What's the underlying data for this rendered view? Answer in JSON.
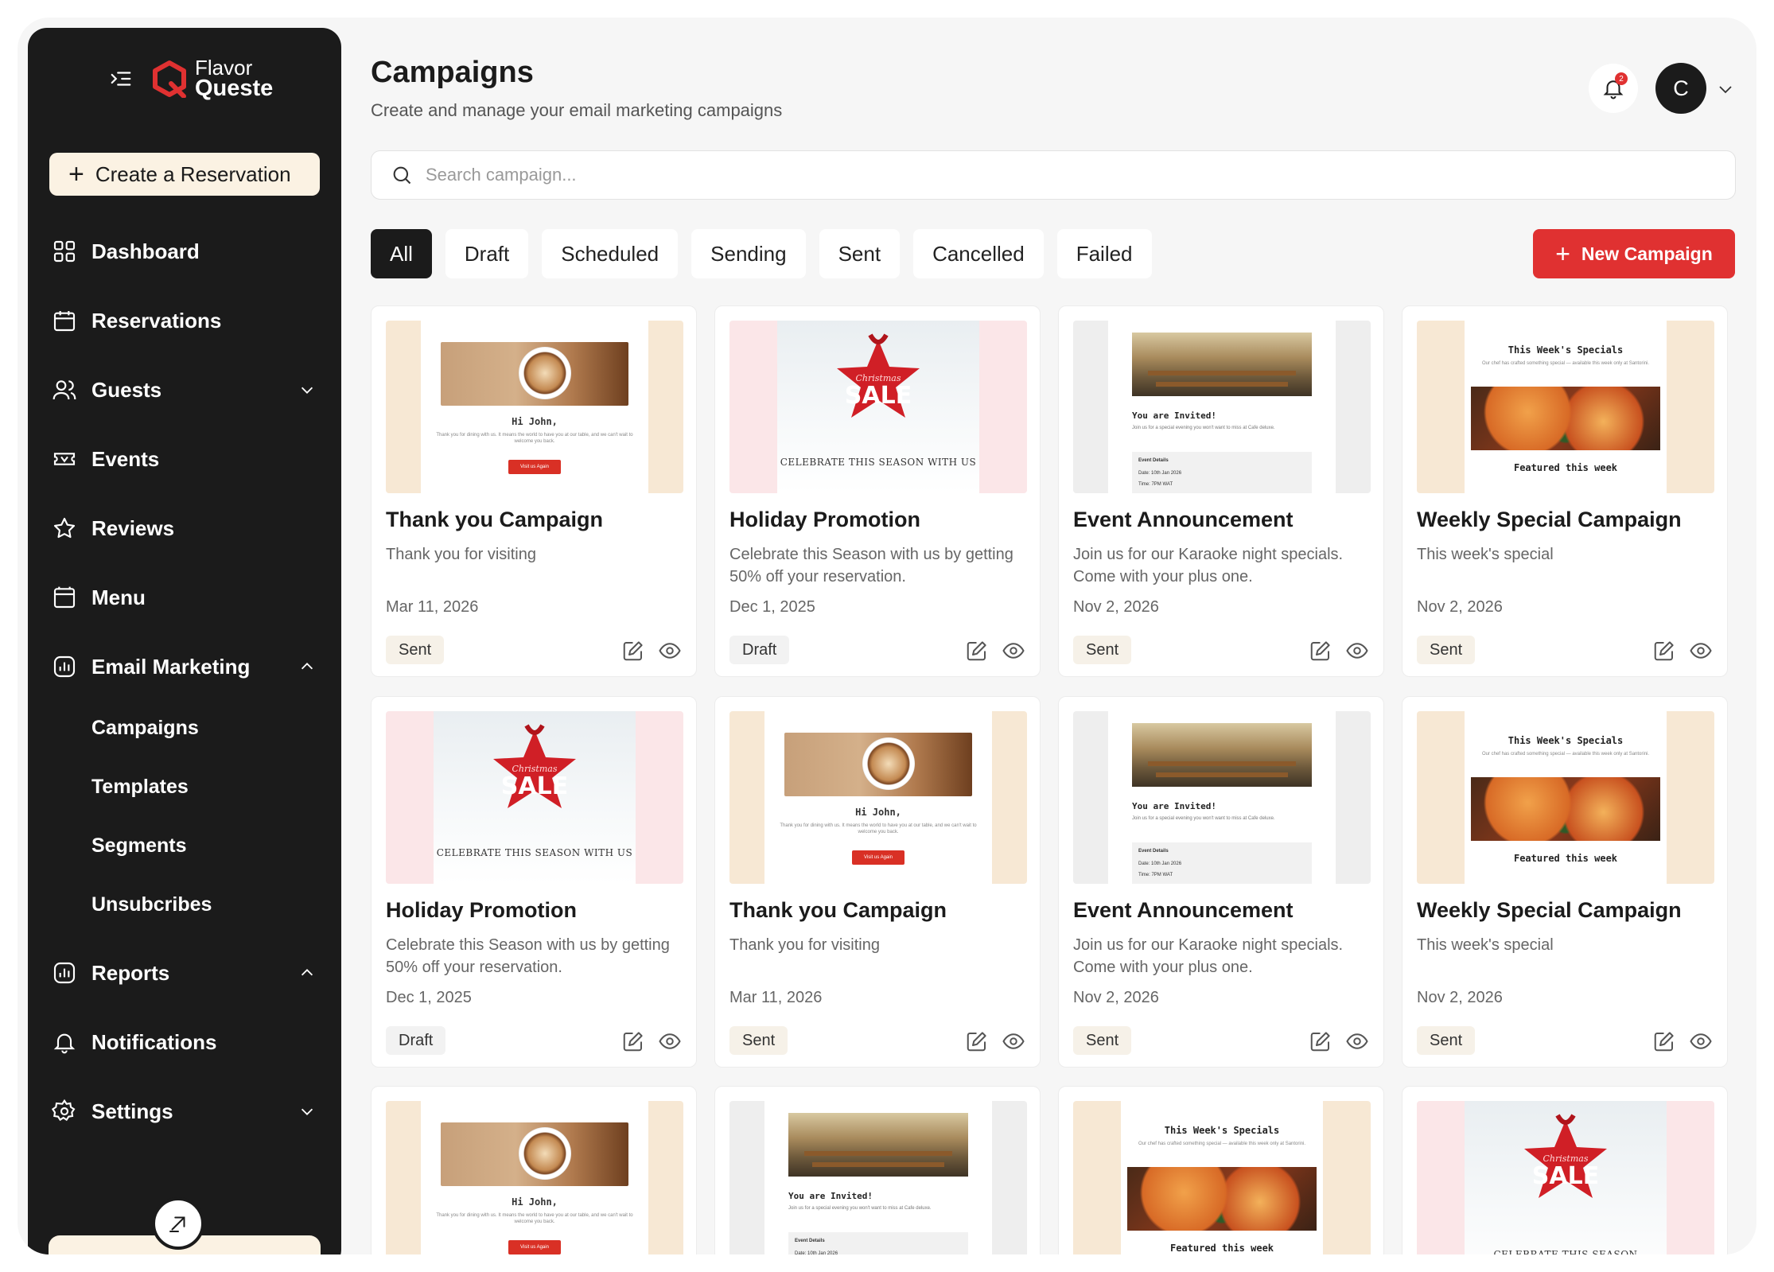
{
  "app": {
    "logo_line1": "Flavor",
    "logo_line2": "Queste",
    "brand_color": "#e03131",
    "sidebar_color": "#1b1b1b"
  },
  "sidebar": {
    "reserve_label": "Create a Reservation",
    "items": [
      {
        "label": "Dashboard",
        "icon": "grid-icon"
      },
      {
        "label": "Reservations",
        "icon": "calendar-icon"
      },
      {
        "label": "Guests",
        "icon": "users-icon"
      },
      {
        "label": "Events",
        "icon": "ticket-icon"
      },
      {
        "label": "Reviews",
        "icon": "star-icon"
      },
      {
        "label": "Menu",
        "icon": "menu-book-icon"
      },
      {
        "label": "Email Marketing",
        "icon": "chart-icon"
      },
      {
        "label": "Reports",
        "icon": "chart-icon"
      },
      {
        "label": "Notifications",
        "icon": "bell-icon"
      },
      {
        "label": "Settings",
        "icon": "gear-icon"
      }
    ],
    "email_sub": [
      "Campaigns",
      "Templates",
      "Segments",
      "Unsubcribes"
    ]
  },
  "header": {
    "title": "Campaigns",
    "subtitle": "Create and manage your email marketing campaigns",
    "notification_count": "2",
    "avatar_initial": "C"
  },
  "search": {
    "placeholder": "Search campaign..."
  },
  "tabs": [
    "All",
    "Draft",
    "Scheduled",
    "Sending",
    "Sent",
    "Cancelled",
    "Failed"
  ],
  "new_campaign_label": "New Campaign",
  "thumbs": {
    "coffee_greeting": "Hi John,",
    "coffee_text": "Thank you for dining with us. It means the world to have you at our table, and we can't wait to welcome you back.",
    "coffee_cta": "Visit us Again",
    "sale_caption": "CELEBRATE THIS SEASON WITH US",
    "sale_caption_short": "CELEBRATE THIS SEASON",
    "sale_word": "SALE",
    "sale_script": "Christmas",
    "event_heading": "You are Invited!",
    "event_text": "Join us for a special evening you won't want to miss at Cafe deluxe.",
    "event_details": "Event Details",
    "event_date": "Date: 10th Jan 2026",
    "event_time": "Time: 7PM WAT",
    "pasta_heading": "This Week's Specials",
    "pasta_text": "Our chef has crafted something special — available this week only at Santorini.",
    "pasta_footer": "Featured this week"
  },
  "cards": [
    {
      "title": "Thank you Campaign",
      "desc": "Thank you for visiting",
      "date": "Mar 11, 2026",
      "status": "Sent"
    },
    {
      "title": "Holiday Promotion",
      "desc": "Celebrate this Season with us by getting 50% off your reservation.",
      "date": "Dec 1, 2025",
      "status": "Draft"
    },
    {
      "title": "Event Announcement",
      "desc": "Join us for our Karaoke night specials. Come with your plus one.",
      "date": "Nov 2, 2026",
      "status": "Sent"
    },
    {
      "title": "Weekly Special Campaign",
      "desc": "This week's special",
      "date": "Nov 2, 2026",
      "status": "Sent"
    },
    {
      "title": "Holiday Promotion",
      "desc": "Celebrate this Season with us by getting 50% off your reservation.",
      "date": "Dec 1, 2025",
      "status": "Draft"
    },
    {
      "title": "Thank you Campaign",
      "desc": "Thank you for visiting",
      "date": "Mar 11, 2026",
      "status": "Sent"
    },
    {
      "title": "Event Announcement",
      "desc": "Join us for our Karaoke night specials. Come with your plus one.",
      "date": "Nov 2, 2026",
      "status": "Sent"
    },
    {
      "title": "Weekly Special Campaign",
      "desc": "This week's special",
      "date": "Nov 2, 2026",
      "status": "Sent"
    }
  ]
}
